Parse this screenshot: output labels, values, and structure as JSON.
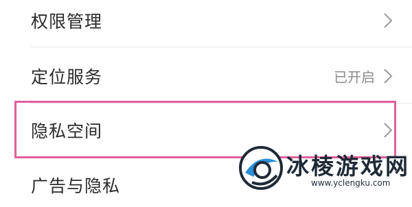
{
  "settings_list": {
    "items": [
      {
        "label": "权限管理",
        "value": ""
      },
      {
        "label": "定位服务",
        "value": "已开启"
      },
      {
        "label": "隐私空间",
        "value": ""
      },
      {
        "label": "广告与隐私",
        "value": ""
      }
    ]
  },
  "highlight": {
    "color": "#e0609a"
  },
  "watermark": {
    "title": "冰棱游戏网",
    "url": "www.yclengku.com",
    "logo_icon": "disc-logo-icon",
    "accent_color": "#2a8fd6"
  },
  "icons": {
    "chevron": "chevron-right-icon"
  }
}
